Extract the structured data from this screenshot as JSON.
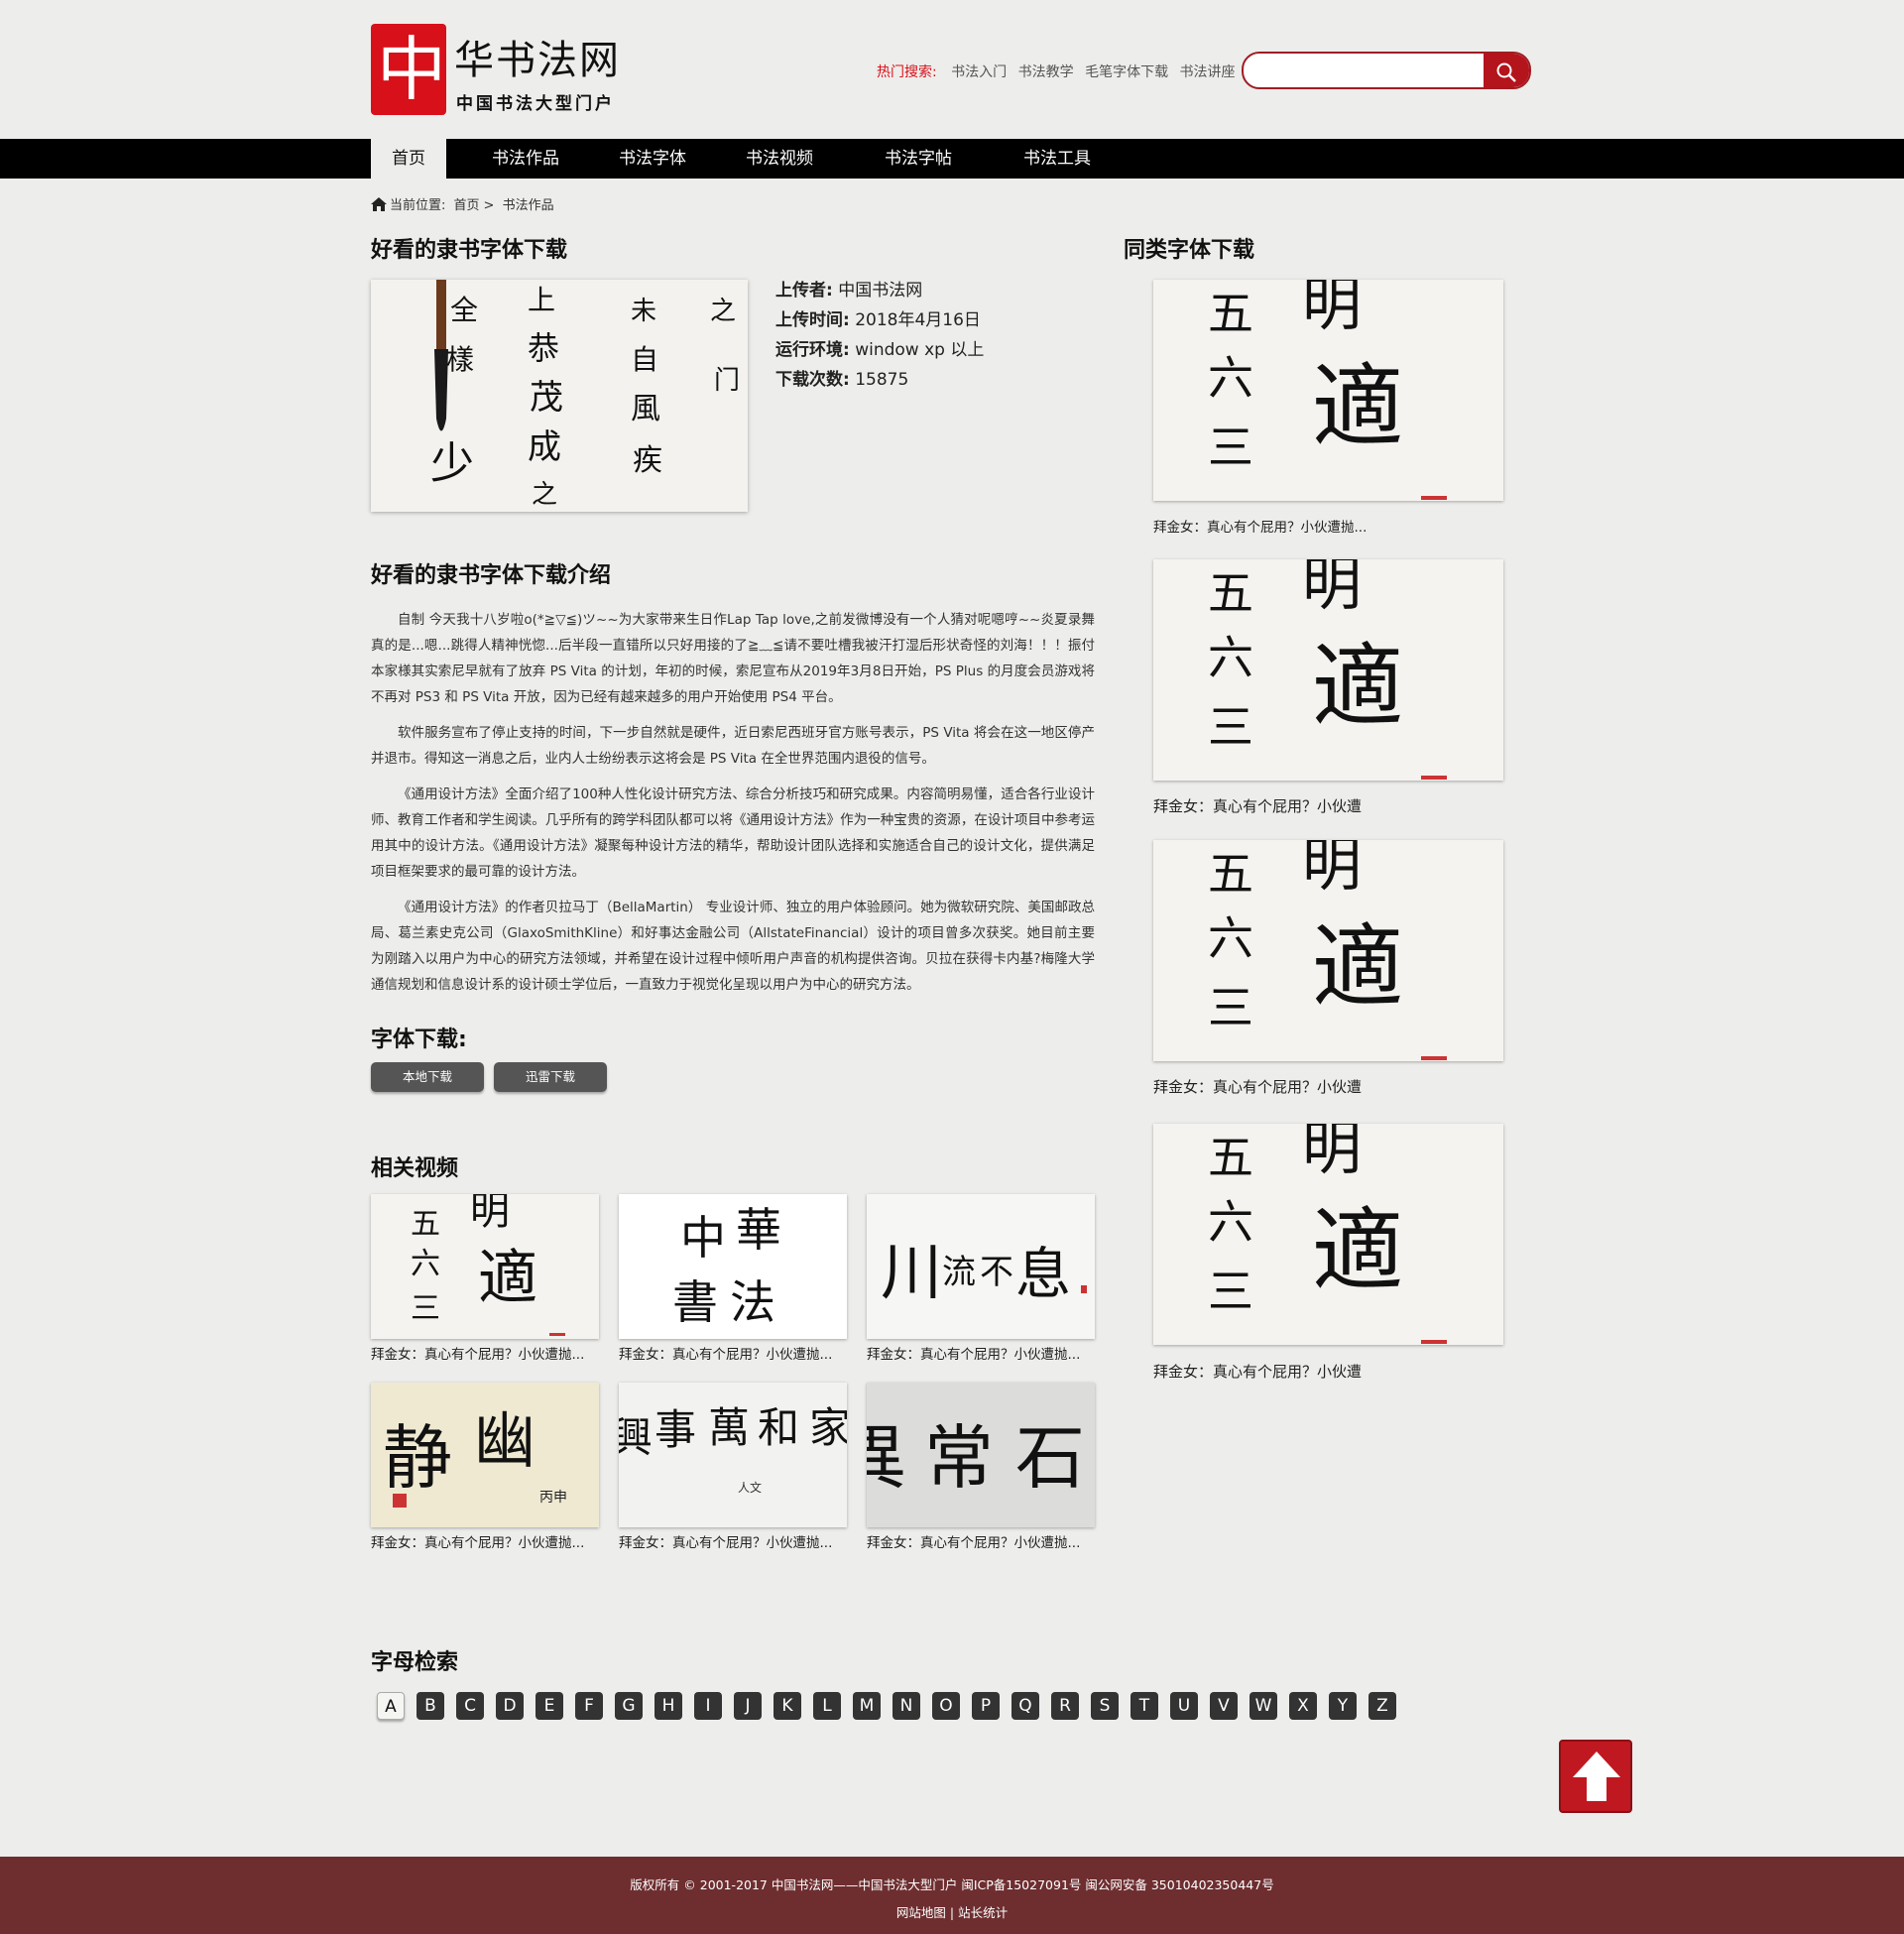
{
  "header": {
    "logo_seal": "中",
    "logo_title": "华书法网",
    "logo_sub": "中国书法大型门户",
    "hot_label": "热门搜索:",
    "hot_keywords": [
      "书法入门",
      "书法教学",
      "毛笔字体下载",
      "书法讲座"
    ],
    "search_placeholder": ""
  },
  "nav": [
    "首页",
    "书法作品",
    "书法字体",
    "书法视频",
    "书法字帖",
    "书法工具"
  ],
  "breadcrumb": {
    "label": "当前位置:",
    "home": "首页",
    "sep": ">",
    "current": "书法作品"
  },
  "article": {
    "title": "好看的隶书字体下载",
    "uploader_label": "上传者:",
    "uploader": "中国书法网",
    "time_label": "上传时间:",
    "time": "2018年4月16日",
    "env_label": "运行环境:",
    "env": "window xp 以上",
    "count_label": "下载次数:",
    "count": "15875",
    "intro_title": "好看的隶书字体下载介绍",
    "paragraphs": [
      "自制 今天我十八岁啦o(*≧▽≦)ツ~~为大家带来生日作Lap Tap love,之前发微博没有一个人猜对呢嗯哼~~炎夏录舞真的是...嗯...跳得人精神恍惚...后半段一直错所以只好用接的了≧﹏≦请不要吐槽我被汗打湿后形状奇怪的刘海！！！振付本家様其实索尼早就有了放弃 PS Vita 的计划，年初的时候，索尼宣布从2019年3月8日开始，PS Plus 的月度会员游戏将不再对 PS3 和 PS Vita 开放，因为已经有越来越多的用户开始使用 PS4 平台。",
      "软件服务宣布了停止支持的时间，下一步自然就是硬件，近日索尼西班牙官方账号表示，PS Vita 将会在这一地区停产并退市。得知这一消息之后，业内人士纷纷表示这将会是 PS Vita 在全世界范围内退役的信号。",
      "《通用设计方法》全面介绍了100种人性化设计研究方法、综合分析技巧和研究成果。内容简明易懂，适合各行业设计师、教育工作者和学生阅读。几乎所有的跨学科团队都可以将《通用设计方法》作为一种宝贵的资源，在设计项目中参考运用其中的设计方法。《通用设计方法》凝聚每种设计方法的精华，帮助设计团队选择和实施适合自己的设计文化，提供满足项目框架要求的最可靠的设计方法。",
      "《通用设计方法》的作者贝拉马丁（BellaMartin） 专业设计师、独立的用户体验顾问。她为微软研究院、美国邮政总局、葛兰素史克公司（GlaxoSmithKline）和好事达金融公司（AllstateFinancial）设计的项目曾多次获奖。她目前主要为刚踏入以用户为中心的研究方法领域，并希望在设计过程中倾听用户声音的机构提供咨询。贝拉在获得卡内基?梅隆大学通信规划和信息设计系的设计硕士学位后，一直致力于视觉化呈现以用户为中心的研究方法。"
    ],
    "download_title": "字体下载:",
    "download_local": "本地下载",
    "download_xunlei": "迅雷下载"
  },
  "related": {
    "title": "相关视频",
    "items": [
      {
        "caption": "拜金女：真心有个屁用？小伙遭抛...",
        "art": "明適"
      },
      {
        "caption": "拜金女：真心有个屁用？小伙遭抛...",
        "art": "中華書法"
      },
      {
        "caption": "拜金女：真心有个屁用？小伙遭抛...",
        "art": "川流不息"
      },
      {
        "caption": "拜金女：真心有个屁用？小伙遭抛...",
        "art": "静幽"
      },
      {
        "caption": "拜金女：真心有个屁用？小伙遭抛...",
        "art": "家和萬事興"
      },
      {
        "caption": "拜金女：真心有个屁用？小伙遭抛...",
        "art": "常"
      }
    ]
  },
  "sidebar": {
    "title": "同类字体下载",
    "items": [
      {
        "caption": "拜金女：真心有个屁用？小伙遭抛...",
        "art": "明適"
      },
      {
        "caption": "拜金女：真心有个屁用？小伙遭",
        "art": "明適"
      },
      {
        "caption": "拜金女：真心有个屁用？小伙遭",
        "art": "明適"
      },
      {
        "caption": "拜金女：真心有个屁用？小伙遭",
        "art": "明適"
      }
    ]
  },
  "letters": {
    "title": "字母检索",
    "items": [
      "A",
      "B",
      "C",
      "D",
      "E",
      "F",
      "G",
      "H",
      "I",
      "J",
      "K",
      "L",
      "M",
      "N",
      "O",
      "P",
      "Q",
      "R",
      "S",
      "T",
      "U",
      "V",
      "W",
      "X",
      "Y",
      "Z"
    ],
    "active": "A"
  },
  "footer": {
    "copyright": "版权所有 © 2001-2017 中国书法网——中国书法大型门户 闽ICP备15027091号 闽公网安备 35010402350447号",
    "sitemap": "网站地图",
    "sep": "|",
    "stats": "站长统计"
  },
  "colors": {
    "brand_red": "#d8101a",
    "nav_bg": "#000000",
    "footer_bg": "#6e2e30",
    "button_gray": "#555555"
  }
}
